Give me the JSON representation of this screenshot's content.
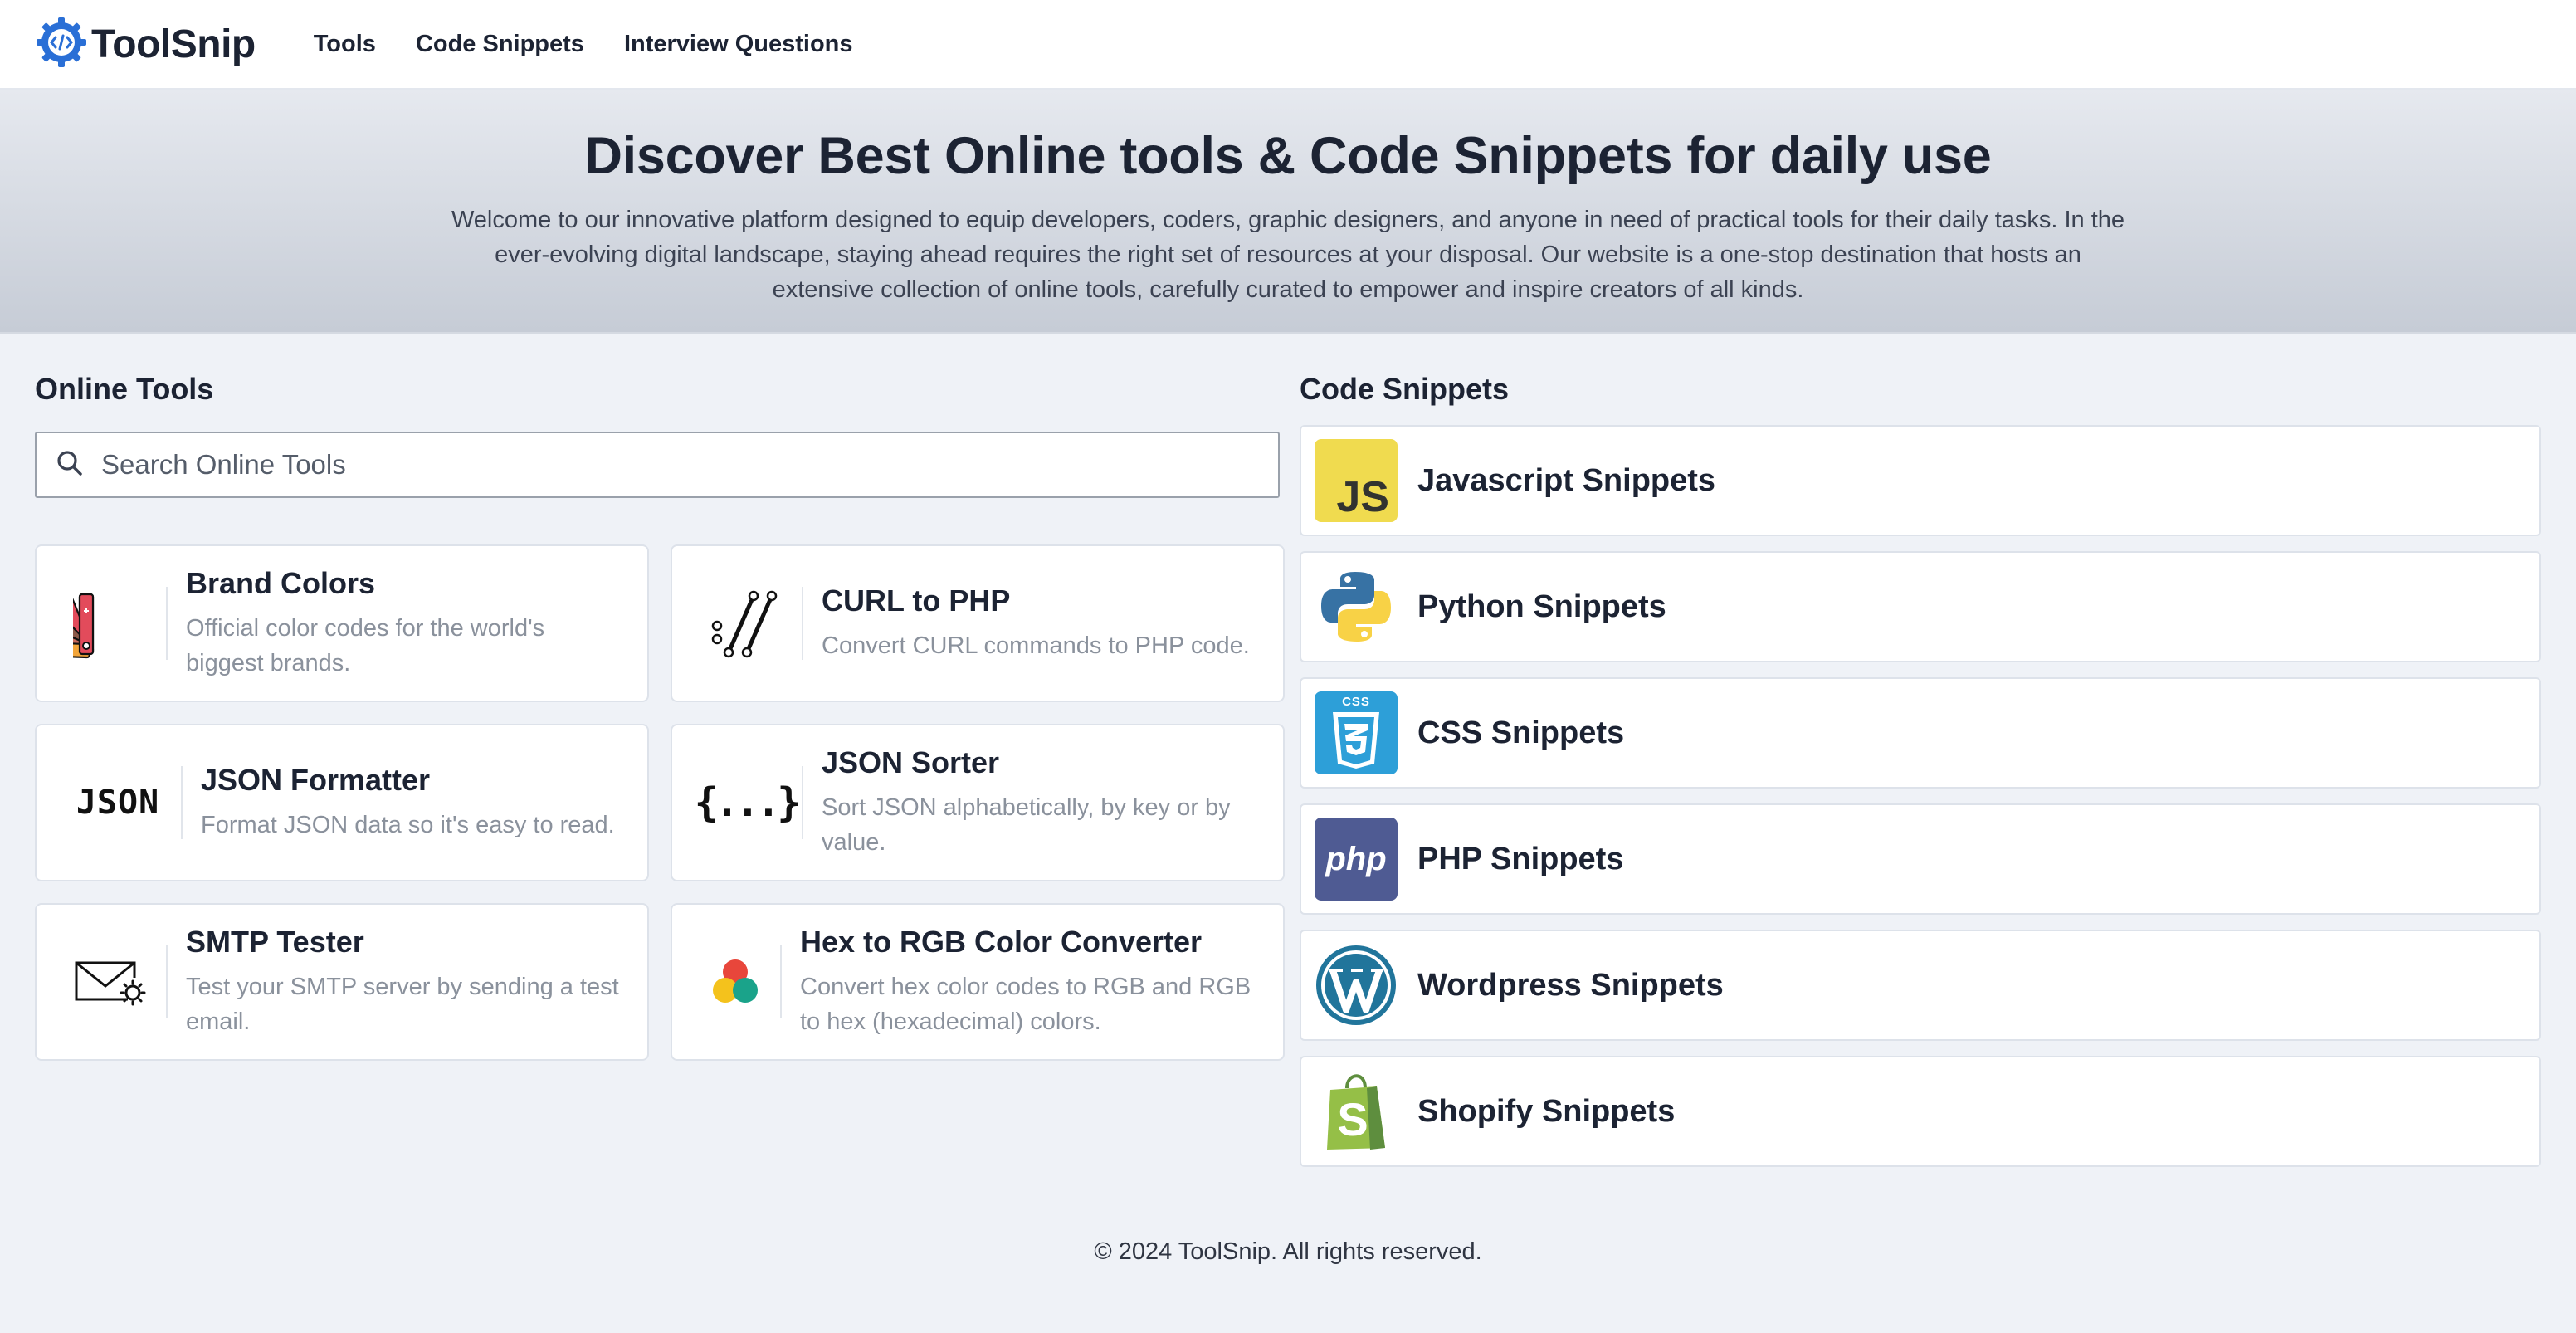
{
  "nav": {
    "brand": "ToolSnip",
    "logo_icon": "code-gear-icon",
    "links": [
      "Tools",
      "Code Snippets",
      "Interview Questions"
    ]
  },
  "hero": {
    "title": "Discover Best Online tools & Code Snippets for daily use",
    "description": "Welcome to our innovative platform designed to equip developers, coders, graphic designers, and anyone in need of practical tools for their daily tasks. In the ever-evolving digital landscape, staying ahead requires the right set of resources at your disposal. Our website is a one-stop destination that hosts an extensive collection of online tools, carefully curated to empower and inspire creators of all kinds."
  },
  "tools": {
    "heading": "Online Tools",
    "search_placeholder": "Search Online Tools",
    "search_icon": "search-icon",
    "items": [
      {
        "title": "Brand Colors",
        "desc": "Official color codes for the world's biggest brands.",
        "icon": "color-swatch-fan-icon"
      },
      {
        "title": "CURL to PHP",
        "desc": "Convert CURL commands to PHP code.",
        "icon": "curl-slashes-icon"
      },
      {
        "title": "JSON Formatter",
        "desc": "Format JSON data so it's easy to read.",
        "icon": "json-text-icon",
        "icon_text": "JSON"
      },
      {
        "title": "JSON Sorter",
        "desc": "Sort JSON alphabetically, by key or by value.",
        "icon": "curly-braces-icon",
        "icon_text": "{...}"
      },
      {
        "title": "SMTP Tester",
        "desc": "Test your SMTP server by sending a test email.",
        "icon": "envelope-gear-icon"
      },
      {
        "title": "Hex to RGB Color Converter",
        "desc": "Convert hex color codes to RGB and RGB to hex (hexadecimal) colors.",
        "icon": "rgb-circles-icon"
      }
    ]
  },
  "snippets": {
    "heading": "Code Snippets",
    "items": [
      {
        "label": "Javascript Snippets",
        "icon": "javascript-logo-icon",
        "logo_text": "JS"
      },
      {
        "label": "Python Snippets",
        "icon": "python-logo-icon"
      },
      {
        "label": "CSS Snippets",
        "icon": "css3-logo-icon",
        "logo_text": "CSS"
      },
      {
        "label": "PHP Snippets",
        "icon": "php-logo-icon",
        "logo_text": "php"
      },
      {
        "label": "Wordpress Snippets",
        "icon": "wordpress-logo-icon"
      },
      {
        "label": "Shopify Snippets",
        "icon": "shopify-logo-icon",
        "logo_text": "S"
      }
    ]
  },
  "colors": {
    "js_yellow": "#f0db4f",
    "css_blue": "#2d9fd8",
    "php_purple": "#4f5b93",
    "wordpress_blue": "#21759b",
    "shopify_green": "#95bf47",
    "brand_blue": "#2a6fd6"
  },
  "footer": {
    "text": "© 2024 ToolSnip. All rights reserved."
  }
}
